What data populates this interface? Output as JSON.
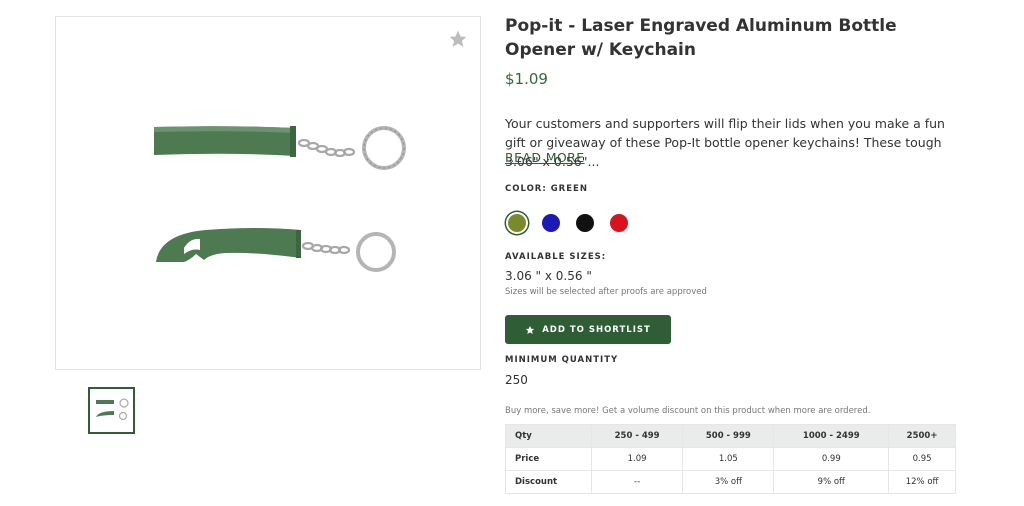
{
  "product": {
    "title": "Pop-it - Laser Engraved Aluminum Bottle Opener w/ Keychain",
    "price": "$1.09",
    "description": "Your customers and supporters will flip their lids when you make a fun gift or giveaway of these Pop-It bottle opener keychains! These tough 3.06\" x 0.56\"...",
    "read_more": "READ MORE"
  },
  "color": {
    "label": "COLOR: GREEN",
    "swatches": [
      {
        "name": "green",
        "hex": "#7a8a2a",
        "selected": true
      },
      {
        "name": "blue",
        "hex": "#1a1ab8",
        "selected": false
      },
      {
        "name": "black",
        "hex": "#111111",
        "selected": false
      },
      {
        "name": "red",
        "hex": "#d8121e",
        "selected": false
      }
    ]
  },
  "sizes": {
    "label": "AVAILABLE SIZES:",
    "value": "3.06 \" x 0.56 \"",
    "note": "Sizes will be selected after proofs are approved"
  },
  "shortlist": {
    "label": "ADD TO SHORTLIST",
    "icon": "star-icon"
  },
  "min_qty": {
    "label": "MINIMUM QUANTITY",
    "value": "250"
  },
  "volume_note": "Buy more, save more! Get a volume discount on this product when more are ordered.",
  "pricing_table": {
    "header": [
      "Qty",
      "250 - 499",
      "500 - 999",
      "1000 - 2499",
      "2500+"
    ],
    "rows": [
      [
        "Price",
        "1.09",
        "1.05",
        "0.99",
        "0.95"
      ],
      [
        "Discount",
        "--",
        "3% off",
        "9% off",
        "12% off"
      ]
    ]
  },
  "colors": {
    "accent": "#2e5d36",
    "price": "#2e6b38",
    "product_green": "#4e7a52"
  }
}
